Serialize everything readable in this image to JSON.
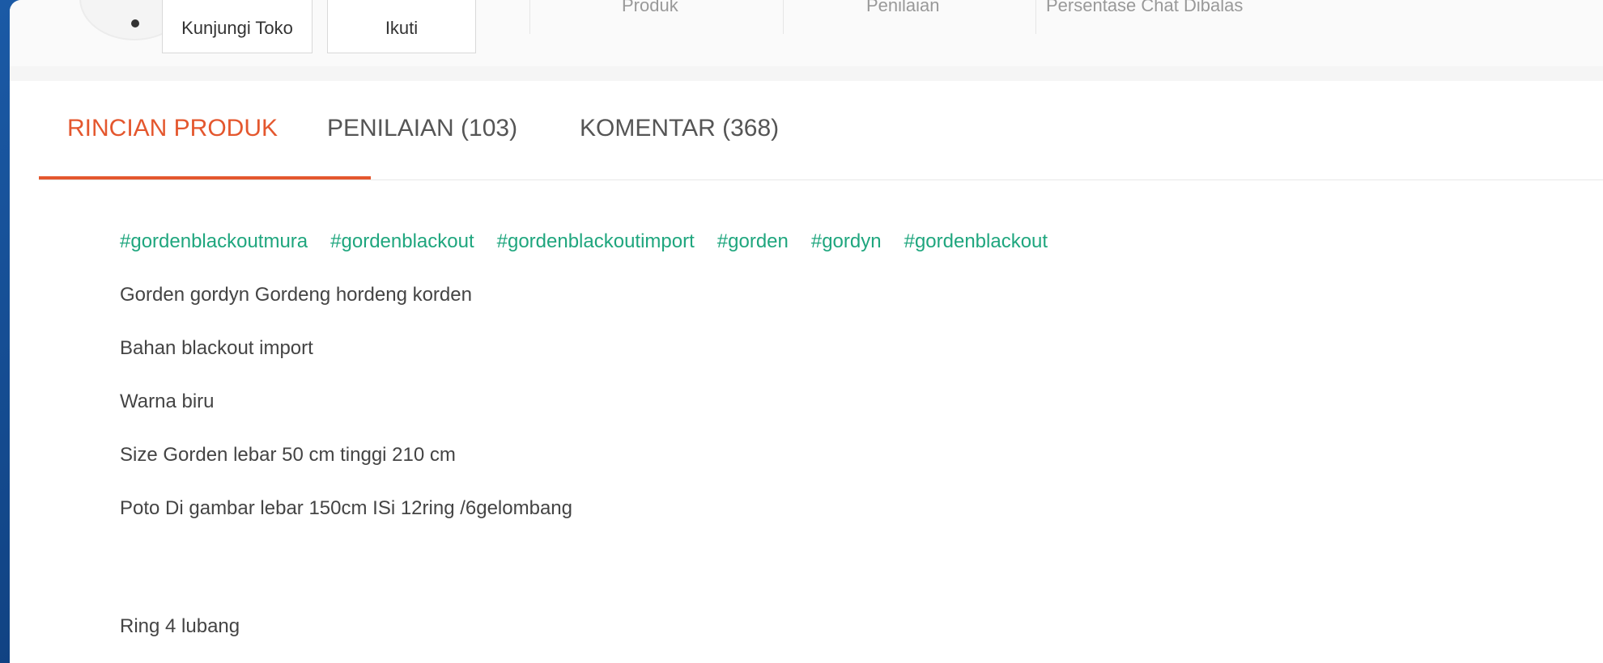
{
  "shop": {
    "visit_label": "Kunjungi Toko",
    "follow_label": "Ikuti",
    "stats": [
      "Produk",
      "Penilaian",
      "Persentase Chat Dibalas"
    ]
  },
  "tabs": [
    {
      "label": "RINCIAN PRODUK",
      "active": true
    },
    {
      "label": "PENILAIAN (103)",
      "active": false
    },
    {
      "label": "KOMENTAR (368)",
      "active": false
    }
  ],
  "description": {
    "hashtags": [
      "#gordenblackoutmura",
      "#gordenblackout",
      "#gordenblackoutimport",
      "#gorden",
      "#gordyn",
      "#gordenblackout"
    ],
    "lines": [
      "Gorden gordyn Gordeng hordeng  korden",
      "Bahan  blackout  import",
      "Warna  biru",
      "Size  Gorden  lebar 50 cm tinggi 210 cm",
      "Poto  Di gambar lebar 150cm ISi 12ring /6gelombang",
      "Ring 4 lubang"
    ]
  },
  "colors": {
    "accent": "#e4572e",
    "hashtag": "#1fa67e",
    "frame": "#0b3670"
  }
}
